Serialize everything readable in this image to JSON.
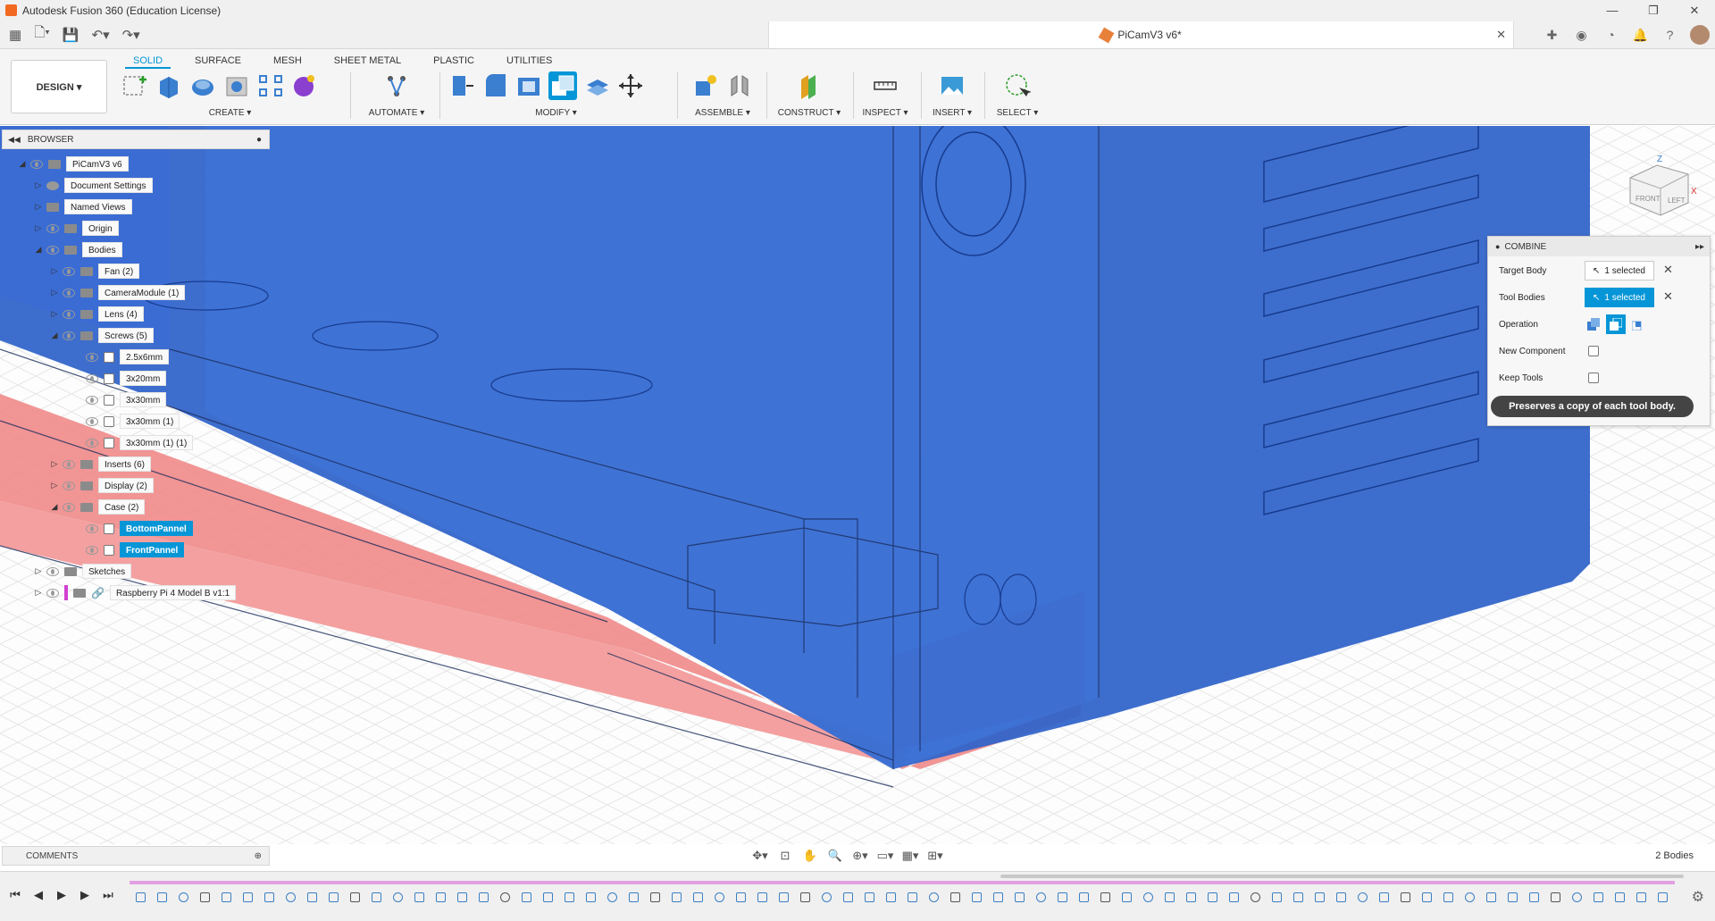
{
  "window": {
    "title": "Autodesk Fusion 360 (Education License)",
    "minimize": "—",
    "restore": "❐",
    "close": "✕"
  },
  "document": {
    "name": "PiCamV3 v6*",
    "close": "✕"
  },
  "workspace": {
    "label": "DESIGN ▾"
  },
  "tabs": [
    "SOLID",
    "SURFACE",
    "MESH",
    "SHEET METAL",
    "PLASTIC",
    "UTILITIES"
  ],
  "groups": {
    "create": "CREATE ▾",
    "automate": "AUTOMATE ▾",
    "modify": "MODIFY ▾",
    "assemble": "ASSEMBLE ▾",
    "construct": "CONSTRUCT ▾",
    "inspect": "INSPECT ▾",
    "insert": "INSERT ▾",
    "select": "SELECT ▾"
  },
  "browser": {
    "title": "BROWSER",
    "items": [
      {
        "label": "PiCamV3 v6"
      },
      {
        "label": "Document Settings"
      },
      {
        "label": "Named Views"
      },
      {
        "label": "Origin"
      },
      {
        "label": "Bodies"
      },
      {
        "label": "Fan (2)"
      },
      {
        "label": "CameraModule (1)"
      },
      {
        "label": "Lens (4)"
      },
      {
        "label": "Screws (5)"
      },
      {
        "label": "2.5x6mm"
      },
      {
        "label": "3x20mm"
      },
      {
        "label": "3x30mm"
      },
      {
        "label": "3x30mm (1)"
      },
      {
        "label": "3x30mm (1) (1)"
      },
      {
        "label": "Inserts (6)"
      },
      {
        "label": "Display (2)"
      },
      {
        "label": "Case (2)"
      },
      {
        "label": "BottomPannel"
      },
      {
        "label": "FrontPannel"
      },
      {
        "label": "Sketches"
      },
      {
        "label": "Raspberry Pi 4 Model B v1:1"
      }
    ]
  },
  "combine": {
    "title": "COMBINE",
    "target_body_label": "Target Body",
    "target_body_value": "1 selected",
    "tool_bodies_label": "Tool Bodies",
    "tool_bodies_value": "1 selected",
    "operation_label": "Operation",
    "new_component_label": "New Component",
    "keep_tools_label": "Keep Tools",
    "tooltip": "Preserves a copy of each tool body."
  },
  "comments": {
    "title": "COMMENTS"
  },
  "status": {
    "bodies": "2 Bodies"
  },
  "viewcube": {
    "front": "FRONT",
    "left": "LEFT",
    "z": "Z",
    "x": "X"
  },
  "colors": {
    "accent": "#0696d7",
    "blue_body": "#2a5ec9",
    "red_body": "#f07a7a"
  }
}
